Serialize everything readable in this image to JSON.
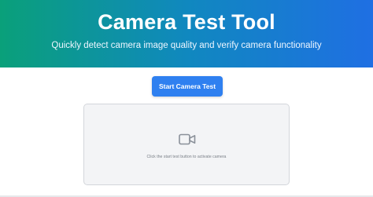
{
  "header": {
    "title": "Camera Test Tool",
    "subtitle": "Quickly detect camera image quality and verify camera functionality"
  },
  "actions": {
    "start_label": "Start Camera Test"
  },
  "camera_panel": {
    "icon": "video-camera-icon",
    "hint": "Click the start test button to activate camera"
  },
  "colors": {
    "gradient_start": "#0aa07a",
    "gradient_end": "#1f6fe3",
    "button": "#2f80f0",
    "panel_background": "#f3f4f6"
  }
}
